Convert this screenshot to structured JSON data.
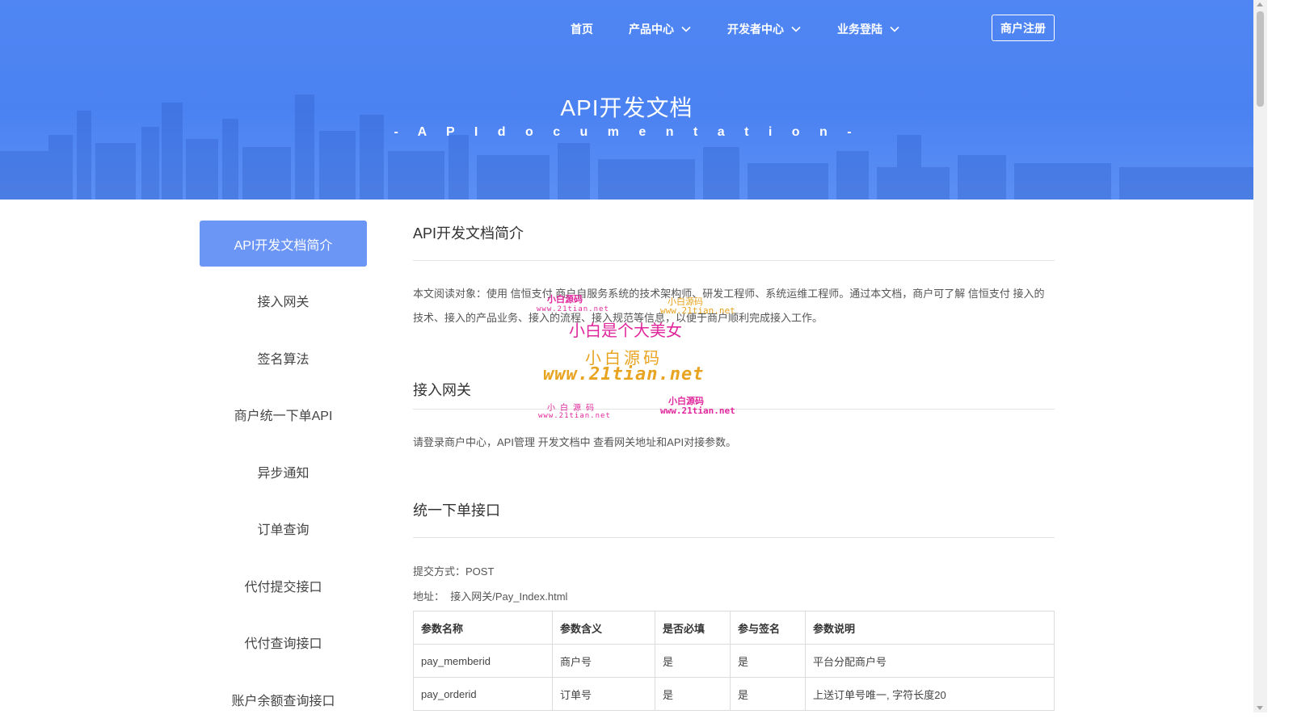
{
  "nav": {
    "items": [
      {
        "label": "首页",
        "dropdown": false
      },
      {
        "label": "产品中心",
        "dropdown": true
      },
      {
        "label": "开发者中心",
        "dropdown": true
      },
      {
        "label": "业务登陆",
        "dropdown": true
      }
    ],
    "register_label": "商户注册"
  },
  "hero": {
    "title": "API开发文档",
    "subtitle": "- A P I   d o c u m e n t a t i o n   -"
  },
  "sidebar": {
    "items": [
      {
        "label": "API开发文档简介",
        "active": true
      },
      {
        "label": "接入网关",
        "active": false
      },
      {
        "label": "签名算法",
        "active": false
      },
      {
        "label": "商户统一下单API",
        "active": false
      },
      {
        "label": "异步通知",
        "active": false
      },
      {
        "label": "订单查询",
        "active": false
      },
      {
        "label": "代付提交接口",
        "active": false
      },
      {
        "label": "代付查询接口",
        "active": false
      },
      {
        "label": "账户余额查询接口",
        "active": false
      }
    ]
  },
  "content": {
    "intro": {
      "title": "API开发文档简介",
      "text": "本文阅读对象：使用 信恒支付 商户自服务系统的技术架构师、研发工程师、系统运维工程师。通过本文档，商户可了解 信恒支付 接入的技术、接入的产品业务、接入的流程、接入规范等信息，以便于商户顺利完成接入工作。"
    },
    "gateway": {
      "title": "接入网关",
      "text": "请登录商户中心，API管理 开发文档中 查看网关地址和API对接参数。"
    },
    "order": {
      "title": "统一下单接口",
      "method": "提交方式：POST",
      "address": "地址：  接入网关/Pay_Index.html",
      "table": {
        "headers": [
          "参数名称",
          "参数含义",
          "是否必填",
          "参与签名",
          "参数说明"
        ],
        "rows": [
          [
            "pay_memberid",
            "商户号",
            "是",
            "是",
            "平台分配商户号"
          ],
          [
            "pay_orderid",
            "订单号",
            "是",
            "是",
            "上送订单号唯一, 字符长度20"
          ]
        ]
      }
    }
  },
  "watermarks": {
    "large_line1": "小白是个大美女",
    "large_line2": "小白源码",
    "large_line3": "www.21tian.net",
    "small_brand": "小白源码",
    "small_brand_spaced": "小 白 源 码",
    "small_url": "www.21tian.net"
  },
  "colors": {
    "hero_blue": "#4f86f3",
    "active_tab": "#6c96f6",
    "watermark_pink": "#e0279b",
    "watermark_orange": "#e8a420"
  }
}
